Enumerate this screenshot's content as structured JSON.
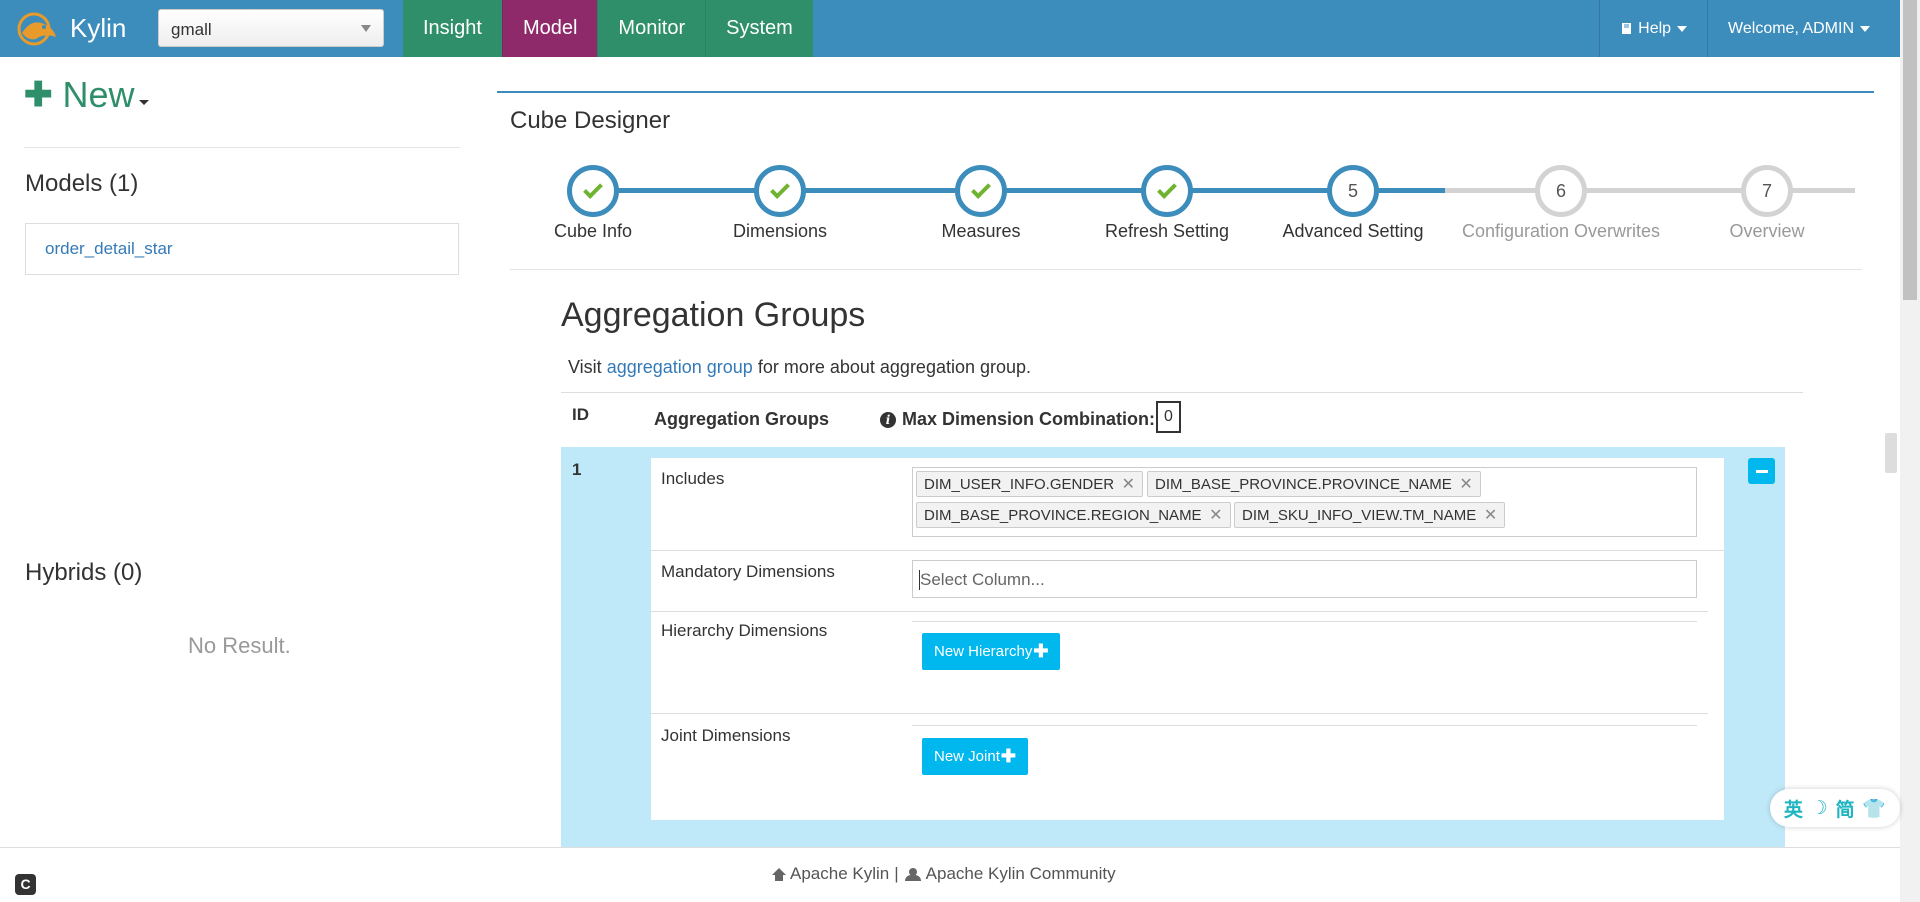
{
  "app": {
    "name": "Kylin"
  },
  "project_select": {
    "value": "gmall"
  },
  "nav": {
    "items": [
      {
        "label": "Insight"
      },
      {
        "label": "Model"
      },
      {
        "label": "Monitor"
      },
      {
        "label": "System"
      }
    ],
    "active": "Model",
    "help_label": "Help",
    "welcome_label": "Welcome, ADMIN"
  },
  "sidebar": {
    "new_label": "New",
    "models_title": "Models (1)",
    "models": [
      "order_detail_star"
    ],
    "hybrids_title": "Hybrids (0)",
    "no_result": "No Result."
  },
  "designer": {
    "title": "Cube Designer",
    "steps": [
      {
        "label": "Cube Info",
        "state": "done",
        "num": "1"
      },
      {
        "label": "Dimensions",
        "state": "done",
        "num": "2"
      },
      {
        "label": "Measures",
        "state": "done",
        "num": "3"
      },
      {
        "label": "Refresh Setting",
        "state": "done",
        "num": "4"
      },
      {
        "label": "Advanced Setting",
        "state": "current",
        "num": "5"
      },
      {
        "label": "Configuration Overwrites",
        "state": "todo",
        "num": "6"
      },
      {
        "label": "Overview",
        "state": "todo",
        "num": "7"
      }
    ],
    "current_step": 5
  },
  "aggregation": {
    "title": "Aggregation Groups",
    "visit_prefix": "Visit",
    "visit_link": "aggregation group",
    "visit_suffix": "for more about aggregation group.",
    "headers": {
      "id": "ID",
      "groups": "Aggregation Groups",
      "max_combination": "Max Dimension Combination:"
    },
    "max_combination_value": "0",
    "group": {
      "id": "1",
      "includes_label": "Includes",
      "includes": [
        "DIM_USER_INFO.GENDER",
        "DIM_BASE_PROVINCE.PROVINCE_NAME",
        "DIM_BASE_PROVINCE.REGION_NAME",
        "DIM_SKU_INFO_VIEW.TM_NAME"
      ],
      "mandatory_label": "Mandatory Dimensions",
      "mandatory_placeholder": "Select Column...",
      "hierarchy_label": "Hierarchy Dimensions",
      "new_hierarchy_label": "New Hierarchy",
      "joint_label": "Joint Dimensions",
      "new_joint_label": "New Joint"
    }
  },
  "footer": {
    "link1": "Apache Kylin",
    "separator": "|",
    "link2": "Apache Kylin Community",
    "corner_icon": "C"
  },
  "ime_widget": {
    "chars": [
      "英",
      "☽",
      "简",
      "👕"
    ]
  },
  "colors": {
    "navbar": "#3c8dbc",
    "nav_item": "#2f8f6a",
    "nav_active": "#8e2a6a",
    "step_done": "#3c8dbc",
    "check": "#6fb330",
    "agg_row_bg": "#bfe9f9",
    "button_blue": "#00b7ee"
  }
}
